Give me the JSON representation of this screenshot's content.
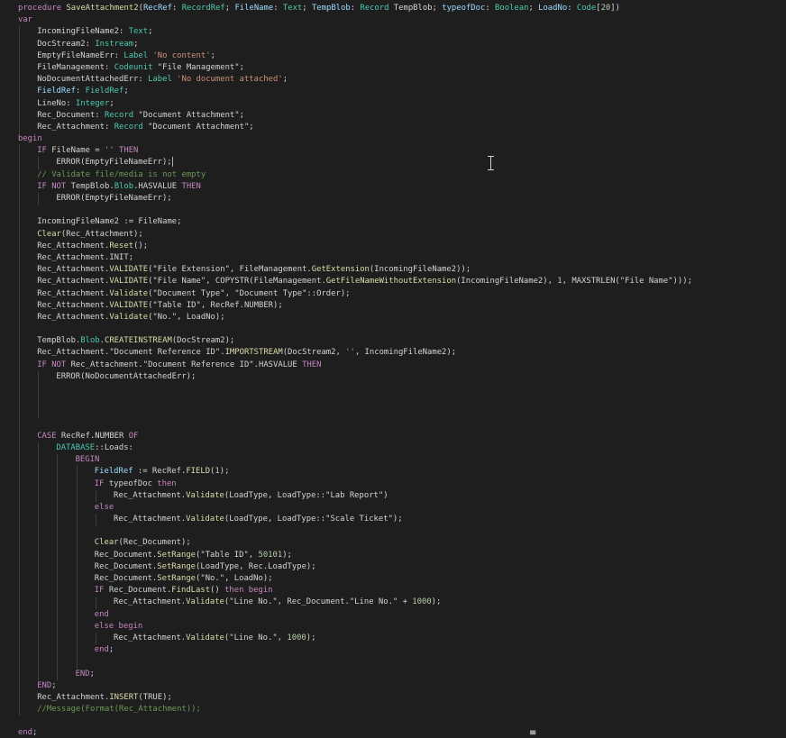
{
  "editor": {
    "theme": {
      "background": "#1e1e1e",
      "keyword": "#c586c0",
      "type": "#4ec9b0",
      "function": "#dcdcaa",
      "variable": "#9cdcfe",
      "string": "#ce9178",
      "number": "#b5cea8",
      "comment": "#6a9955",
      "plain": "#d4d4d4"
    },
    "lines": [
      {
        "indent": 0,
        "cursor": false,
        "tokens": [
          [
            "kw",
            "procedure "
          ],
          [
            "fn",
            "SaveAttachment2"
          ],
          [
            "pl",
            "("
          ],
          [
            "var",
            "RecRef"
          ],
          [
            "pl",
            ": "
          ],
          [
            "ty",
            "RecordRef"
          ],
          [
            "pl",
            "; "
          ],
          [
            "var",
            "FileName"
          ],
          [
            "pl",
            ": "
          ],
          [
            "ty",
            "Text"
          ],
          [
            "pl",
            "; "
          ],
          [
            "var",
            "TempBlob"
          ],
          [
            "pl",
            ": "
          ],
          [
            "ty",
            "Record"
          ],
          [
            "pl",
            " TempBlob; "
          ],
          [
            "var",
            "typeofDoc"
          ],
          [
            "pl",
            ": "
          ],
          [
            "ty",
            "Boolean"
          ],
          [
            "pl",
            "; "
          ],
          [
            "var",
            "LoadNo"
          ],
          [
            "pl",
            ": "
          ],
          [
            "ty",
            "Code"
          ],
          [
            "pl",
            "["
          ],
          [
            "num",
            "20"
          ],
          [
            "pl",
            "])"
          ]
        ]
      },
      {
        "indent": 0,
        "cursor": false,
        "tokens": [
          [
            "kw",
            "var"
          ]
        ]
      },
      {
        "indent": 1,
        "cursor": false,
        "tokens": [
          [
            "pl",
            "IncomingFileName2: "
          ],
          [
            "ty",
            "Text"
          ],
          [
            "pl",
            ";"
          ]
        ]
      },
      {
        "indent": 1,
        "cursor": false,
        "tokens": [
          [
            "pl",
            "DocStream2: "
          ],
          [
            "ty",
            "Instream"
          ],
          [
            "pl",
            ";"
          ]
        ]
      },
      {
        "indent": 1,
        "cursor": false,
        "tokens": [
          [
            "pl",
            "EmptyFileNameErr: "
          ],
          [
            "ty",
            "Label"
          ],
          [
            "pl",
            " "
          ],
          [
            "str",
            "'No content'"
          ],
          [
            "pl",
            ";"
          ]
        ]
      },
      {
        "indent": 1,
        "cursor": false,
        "tokens": [
          [
            "pl",
            "FileManagement: "
          ],
          [
            "ty",
            "Codeunit"
          ],
          [
            "pl",
            " \"File Management\";"
          ]
        ]
      },
      {
        "indent": 1,
        "cursor": false,
        "tokens": [
          [
            "pl",
            "NoDocumentAttachedErr: "
          ],
          [
            "ty",
            "Label"
          ],
          [
            "pl",
            " "
          ],
          [
            "str",
            "'No document attached'"
          ],
          [
            "pl",
            ";"
          ]
        ]
      },
      {
        "indent": 1,
        "cursor": false,
        "tokens": [
          [
            "var",
            "FieldRef"
          ],
          [
            "pl",
            ": "
          ],
          [
            "ty",
            "FieldRef"
          ],
          [
            "pl",
            ";"
          ]
        ]
      },
      {
        "indent": 1,
        "cursor": false,
        "tokens": [
          [
            "pl",
            "LineNo: "
          ],
          [
            "ty",
            "Integer"
          ],
          [
            "pl",
            ";"
          ]
        ]
      },
      {
        "indent": 1,
        "cursor": false,
        "tokens": [
          [
            "pl",
            "Rec_Document: "
          ],
          [
            "ty",
            "Record"
          ],
          [
            "pl",
            " \"Document Attachment\";"
          ]
        ]
      },
      {
        "indent": 1,
        "cursor": false,
        "tokens": [
          [
            "pl",
            "Rec_Attachment: "
          ],
          [
            "ty",
            "Record"
          ],
          [
            "pl",
            " \"Document Attachment\";"
          ]
        ]
      },
      {
        "indent": 0,
        "cursor": false,
        "tokens": [
          [
            "kw",
            "begin"
          ]
        ]
      },
      {
        "indent": 1,
        "cursor": false,
        "tokens": [
          [
            "kw",
            "IF "
          ],
          [
            "pl",
            "FileName = "
          ],
          [
            "str",
            "''"
          ],
          [
            "pl",
            " "
          ],
          [
            "kw",
            "THEN"
          ]
        ]
      },
      {
        "indent": 2,
        "cursor": true,
        "tokens": [
          [
            "pl",
            "ERROR(EmptyFileNameErr);"
          ]
        ]
      },
      {
        "indent": 1,
        "cursor": false,
        "tokens": [
          [
            "cm",
            "// Validate file/media is not empty"
          ]
        ]
      },
      {
        "indent": 1,
        "cursor": false,
        "tokens": [
          [
            "kw",
            "IF NOT "
          ],
          [
            "pl",
            "TempBlob."
          ],
          [
            "ty",
            "Blob"
          ],
          [
            "pl",
            ".HASVALUE "
          ],
          [
            "kw",
            "THEN"
          ]
        ]
      },
      {
        "indent": 2,
        "cursor": false,
        "tokens": [
          [
            "pl",
            "ERROR(EmptyFileNameErr);"
          ]
        ]
      },
      {
        "indent": 1,
        "cursor": false,
        "tokens": []
      },
      {
        "indent": 1,
        "cursor": false,
        "tokens": [
          [
            "pl",
            "IncomingFileName2 := FileName;"
          ]
        ]
      },
      {
        "indent": 1,
        "cursor": false,
        "tokens": [
          [
            "fn",
            "Clear"
          ],
          [
            "pl",
            "(Rec_Attachment);"
          ]
        ]
      },
      {
        "indent": 1,
        "cursor": false,
        "tokens": [
          [
            "pl",
            "Rec_Attachment."
          ],
          [
            "fn",
            "Reset"
          ],
          [
            "pl",
            "();"
          ]
        ]
      },
      {
        "indent": 1,
        "cursor": false,
        "tokens": [
          [
            "pl",
            "Rec_Attachment.INIT;"
          ]
        ]
      },
      {
        "indent": 1,
        "cursor": false,
        "tokens": [
          [
            "pl",
            "Rec_Attachment."
          ],
          [
            "fn",
            "VALIDATE"
          ],
          [
            "pl",
            "(\"File Extension\", FileManagement."
          ],
          [
            "fn",
            "GetExtension"
          ],
          [
            "pl",
            "(IncomingFileName2));"
          ]
        ]
      },
      {
        "indent": 1,
        "cursor": false,
        "tokens": [
          [
            "pl",
            "Rec_Attachment."
          ],
          [
            "fn",
            "VALIDATE"
          ],
          [
            "pl",
            "(\"File Name\", COPYSTR(FileManagement."
          ],
          [
            "fn",
            "GetFileNameWithoutExtension"
          ],
          [
            "pl",
            "(IncomingFileName2), "
          ],
          [
            "num",
            "1"
          ],
          [
            "pl",
            ", MAXSTRLEN(\"File Name\")));"
          ]
        ]
      },
      {
        "indent": 1,
        "cursor": false,
        "tokens": [
          [
            "pl",
            "Rec_Attachment."
          ],
          [
            "fn",
            "Validate"
          ],
          [
            "pl",
            "(\"Document Type\", \"Document Type\"::Order);"
          ]
        ]
      },
      {
        "indent": 1,
        "cursor": false,
        "tokens": [
          [
            "pl",
            "Rec_Attachment."
          ],
          [
            "fn",
            "VALIDATE"
          ],
          [
            "pl",
            "(\"Table ID\", RecRef.NUMBER);"
          ]
        ]
      },
      {
        "indent": 1,
        "cursor": false,
        "tokens": [
          [
            "pl",
            "Rec_Attachment."
          ],
          [
            "fn",
            "Validate"
          ],
          [
            "pl",
            "(\"No.\", LoadNo);"
          ]
        ]
      },
      {
        "indent": 1,
        "cursor": false,
        "tokens": []
      },
      {
        "indent": 1,
        "cursor": false,
        "tokens": [
          [
            "pl",
            "TempBlob."
          ],
          [
            "ty",
            "Blob"
          ],
          [
            "pl",
            "."
          ],
          [
            "fn",
            "CREATEINSTREAM"
          ],
          [
            "pl",
            "(DocStream2);"
          ]
        ]
      },
      {
        "indent": 1,
        "cursor": false,
        "tokens": [
          [
            "pl",
            "Rec_Attachment.\"Document Reference ID\"."
          ],
          [
            "fn",
            "IMPORTSTREAM"
          ],
          [
            "pl",
            "(DocStream2, "
          ],
          [
            "str",
            "''"
          ],
          [
            "pl",
            ", IncomingFileName2);"
          ]
        ]
      },
      {
        "indent": 1,
        "cursor": false,
        "tokens": [
          [
            "kw",
            "IF NOT "
          ],
          [
            "pl",
            "Rec_Attachment.\"Document Reference ID\".HASVALUE "
          ],
          [
            "kw",
            "THEN"
          ]
        ]
      },
      {
        "indent": 2,
        "cursor": false,
        "tokens": [
          [
            "pl",
            "ERROR(NoDocumentAttachedErr);"
          ]
        ]
      },
      {
        "indent": 2,
        "cursor": false,
        "tokens": []
      },
      {
        "indent": 2,
        "cursor": false,
        "tokens": []
      },
      {
        "indent": 2,
        "cursor": false,
        "tokens": []
      },
      {
        "indent": 1,
        "cursor": false,
        "tokens": []
      },
      {
        "indent": 1,
        "cursor": false,
        "tokens": [
          [
            "kw",
            "CASE "
          ],
          [
            "pl",
            "RecRef.NUMBER "
          ],
          [
            "kw",
            "OF"
          ]
        ]
      },
      {
        "indent": 2,
        "cursor": false,
        "tokens": [
          [
            "ty",
            "DATABASE"
          ],
          [
            "pl",
            "::Loads:"
          ]
        ]
      },
      {
        "indent": 3,
        "cursor": false,
        "tokens": [
          [
            "kw",
            "BEGIN"
          ]
        ]
      },
      {
        "indent": 4,
        "cursor": false,
        "tokens": [
          [
            "var",
            "FieldRef"
          ],
          [
            "pl",
            " := RecRef."
          ],
          [
            "fn",
            "FIELD"
          ],
          [
            "pl",
            "("
          ],
          [
            "num",
            "1"
          ],
          [
            "pl",
            ");"
          ]
        ]
      },
      {
        "indent": 4,
        "cursor": false,
        "tokens": [
          [
            "kw",
            "IF "
          ],
          [
            "pl",
            "typeofDoc "
          ],
          [
            "kw",
            "then"
          ]
        ]
      },
      {
        "indent": 5,
        "cursor": false,
        "tokens": [
          [
            "pl",
            "Rec_Attachment."
          ],
          [
            "fn",
            "Validate"
          ],
          [
            "pl",
            "(LoadType, LoadType::\"Lab Report\")"
          ]
        ]
      },
      {
        "indent": 4,
        "cursor": false,
        "tokens": [
          [
            "kw",
            "else"
          ]
        ]
      },
      {
        "indent": 5,
        "cursor": false,
        "tokens": [
          [
            "pl",
            "Rec_Attachment."
          ],
          [
            "fn",
            "Validate"
          ],
          [
            "pl",
            "(LoadType, LoadType::\"Scale Ticket\");"
          ]
        ]
      },
      {
        "indent": 4,
        "cursor": false,
        "tokens": []
      },
      {
        "indent": 4,
        "cursor": false,
        "tokens": [
          [
            "fn",
            "Clear"
          ],
          [
            "pl",
            "(Rec_Document);"
          ]
        ]
      },
      {
        "indent": 4,
        "cursor": false,
        "tokens": [
          [
            "pl",
            "Rec_Document."
          ],
          [
            "fn",
            "SetRange"
          ],
          [
            "pl",
            "(\"Table ID\", "
          ],
          [
            "num",
            "50101"
          ],
          [
            "pl",
            ");"
          ]
        ]
      },
      {
        "indent": 4,
        "cursor": false,
        "tokens": [
          [
            "pl",
            "Rec_Document."
          ],
          [
            "fn",
            "SetRange"
          ],
          [
            "pl",
            "(LoadType, Rec.LoadType);"
          ]
        ]
      },
      {
        "indent": 4,
        "cursor": false,
        "tokens": [
          [
            "pl",
            "Rec_Document."
          ],
          [
            "fn",
            "SetRange"
          ],
          [
            "pl",
            "(\"No.\", LoadNo);"
          ]
        ]
      },
      {
        "indent": 4,
        "cursor": false,
        "tokens": [
          [
            "kw",
            "IF "
          ],
          [
            "pl",
            "Rec_Document."
          ],
          [
            "fn",
            "FindLast"
          ],
          [
            "pl",
            "() "
          ],
          [
            "kw",
            "then begin"
          ]
        ]
      },
      {
        "indent": 5,
        "cursor": false,
        "tokens": [
          [
            "pl",
            "Rec_Attachment."
          ],
          [
            "fn",
            "Validate"
          ],
          [
            "pl",
            "(\"Line No.\", Rec_Document.\"Line No.\" + "
          ],
          [
            "num",
            "1000"
          ],
          [
            "pl",
            ");"
          ]
        ]
      },
      {
        "indent": 4,
        "cursor": false,
        "tokens": [
          [
            "kw",
            "end"
          ]
        ]
      },
      {
        "indent": 4,
        "cursor": false,
        "tokens": [
          [
            "kw",
            "else begin"
          ]
        ]
      },
      {
        "indent": 5,
        "cursor": false,
        "tokens": [
          [
            "pl",
            "Rec_Attachment."
          ],
          [
            "fn",
            "Validate"
          ],
          [
            "pl",
            "(\"Line No.\", "
          ],
          [
            "num",
            "1000"
          ],
          [
            "pl",
            ");"
          ]
        ]
      },
      {
        "indent": 4,
        "cursor": false,
        "tokens": [
          [
            "kw",
            "end"
          ],
          [
            "pl",
            ";"
          ]
        ]
      },
      {
        "indent": 4,
        "cursor": false,
        "tokens": []
      },
      {
        "indent": 3,
        "cursor": false,
        "tokens": [
          [
            "kw",
            "END"
          ],
          [
            "pl",
            ";"
          ]
        ]
      },
      {
        "indent": 1,
        "cursor": false,
        "tokens": [
          [
            "kw",
            "END"
          ],
          [
            "pl",
            ";"
          ]
        ]
      },
      {
        "indent": 1,
        "cursor": false,
        "tokens": [
          [
            "pl",
            "Rec_Attachment."
          ],
          [
            "fn",
            "INSERT"
          ],
          [
            "pl",
            "(TRUE);"
          ]
        ]
      },
      {
        "indent": 1,
        "cursor": false,
        "tokens": [
          [
            "cm",
            "//Message(Format(Rec_Attachment));"
          ]
        ]
      },
      {
        "indent": 0,
        "cursor": false,
        "tokens": []
      },
      {
        "indent": 0,
        "cursor": false,
        "tokens": [
          [
            "kw",
            "end"
          ],
          [
            "pl",
            ";"
          ]
        ]
      }
    ],
    "mouse_pointer": "text-ibeam-icon"
  }
}
